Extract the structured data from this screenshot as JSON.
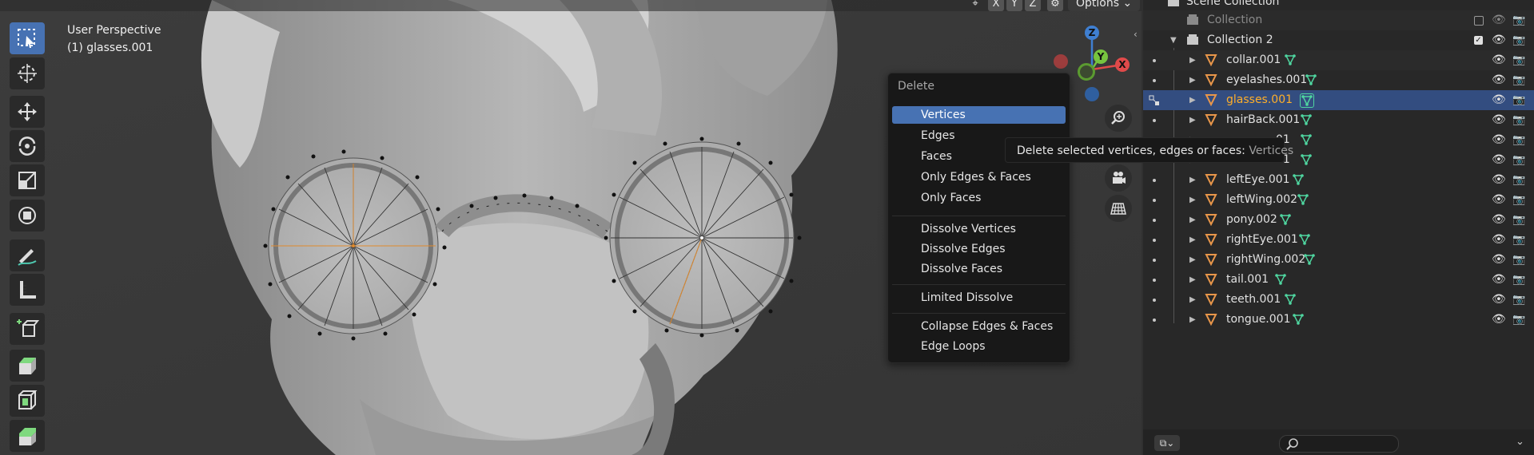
{
  "viewport": {
    "view_name": "User Perspective",
    "object_label": "(1) glasses.001",
    "header": {
      "axis_x": "X",
      "axis_y": "Y",
      "axis_z": "Z",
      "options_label": "Options"
    },
    "gizmo": {
      "z": "Z",
      "y": "Y",
      "x": "X"
    }
  },
  "delete_menu": {
    "title": "Delete",
    "items": [
      {
        "label": "Vertices"
      },
      {
        "label": "Edges"
      },
      {
        "label": "Faces"
      },
      {
        "label": "Only Edges & Faces"
      },
      {
        "label": "Only Faces"
      },
      {
        "label": "Dissolve Vertices"
      },
      {
        "label": "Dissolve Edges"
      },
      {
        "label": "Dissolve Faces"
      },
      {
        "label": "Limited Dissolve"
      },
      {
        "label": "Collapse Edges & Faces"
      },
      {
        "label": "Edge Loops"
      }
    ]
  },
  "tooltip": {
    "text": "Delete selected vertices, edges or faces:",
    "python": "Vertices"
  },
  "outliner": {
    "scene_collection": "Scene Collection",
    "collection": "Collection",
    "collection2": "Collection 2",
    "objects": [
      {
        "name": "collar.001"
      },
      {
        "name": "eyelashes.001"
      },
      {
        "name": "glasses.001"
      },
      {
        "name": "hairBack.001"
      },
      {
        "name": "01"
      },
      {
        "name": "01"
      },
      {
        "name": "leftEye.001"
      },
      {
        "name": "leftWing.002"
      },
      {
        "name": "pony.002"
      },
      {
        "name": "rightEye.001"
      },
      {
        "name": "rightWing.002"
      },
      {
        "name": "tail.001"
      },
      {
        "name": "teeth.001"
      },
      {
        "name": "tongue.001"
      }
    ]
  }
}
